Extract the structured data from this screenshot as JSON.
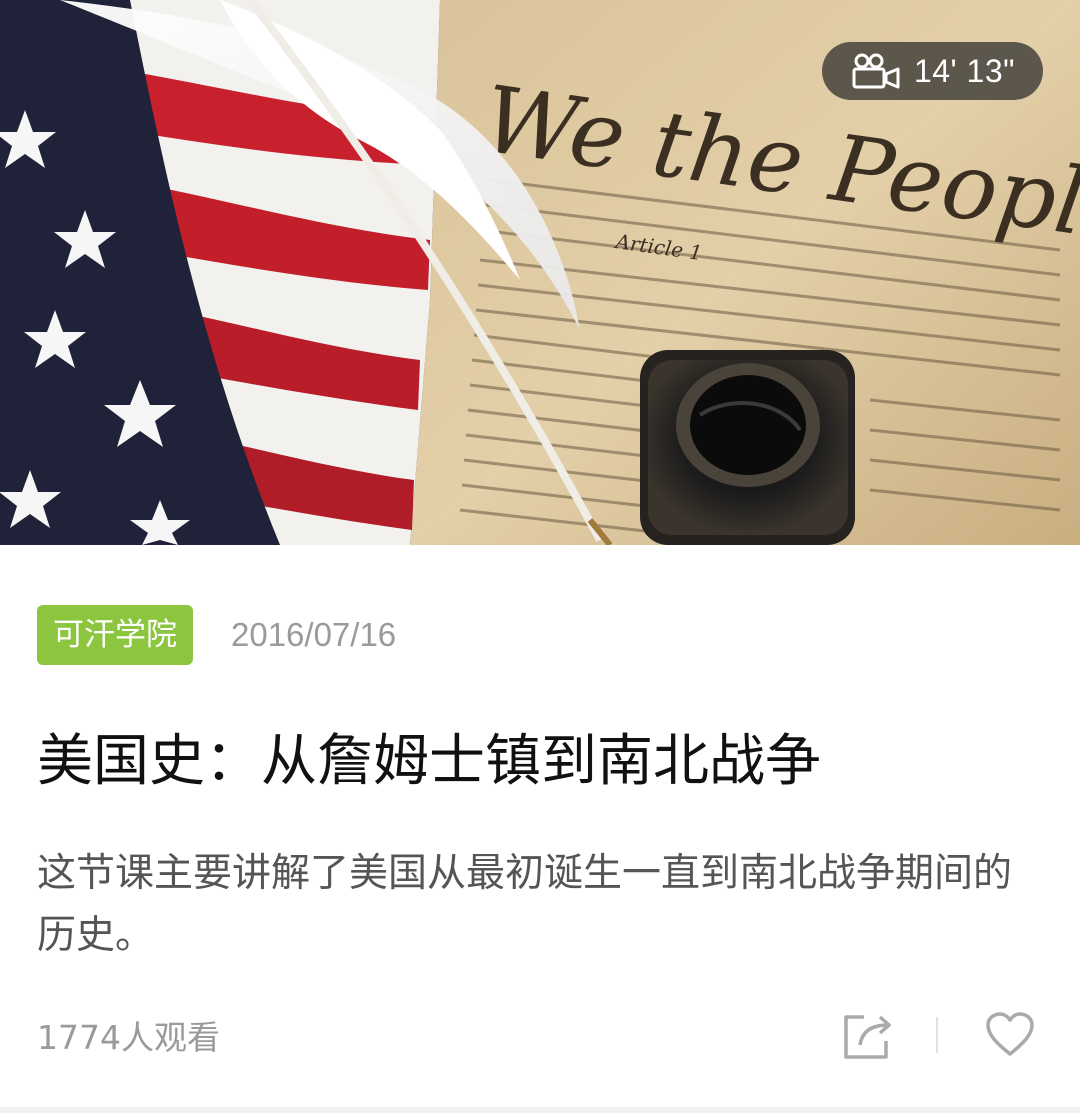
{
  "video": {
    "duration": "14' 13\"",
    "duration_icon": "video-camera-icon"
  },
  "meta": {
    "source": "可汗学院",
    "date": "2016/07/16"
  },
  "title": "美国史：从詹姆士镇到南北战争",
  "summary": "这节课主要讲解了美国从最初诞生一直到南北战争期间的历史。",
  "footer": {
    "views": "1774人观看",
    "share_icon": "share-icon",
    "like_icon": "heart-icon"
  },
  "hero_image": {
    "caption_text": "We the People",
    "article_text": "Article 1"
  },
  "colors": {
    "tag_green": "#8cc63e",
    "title": "#111111",
    "muted": "#9a9a9a"
  }
}
